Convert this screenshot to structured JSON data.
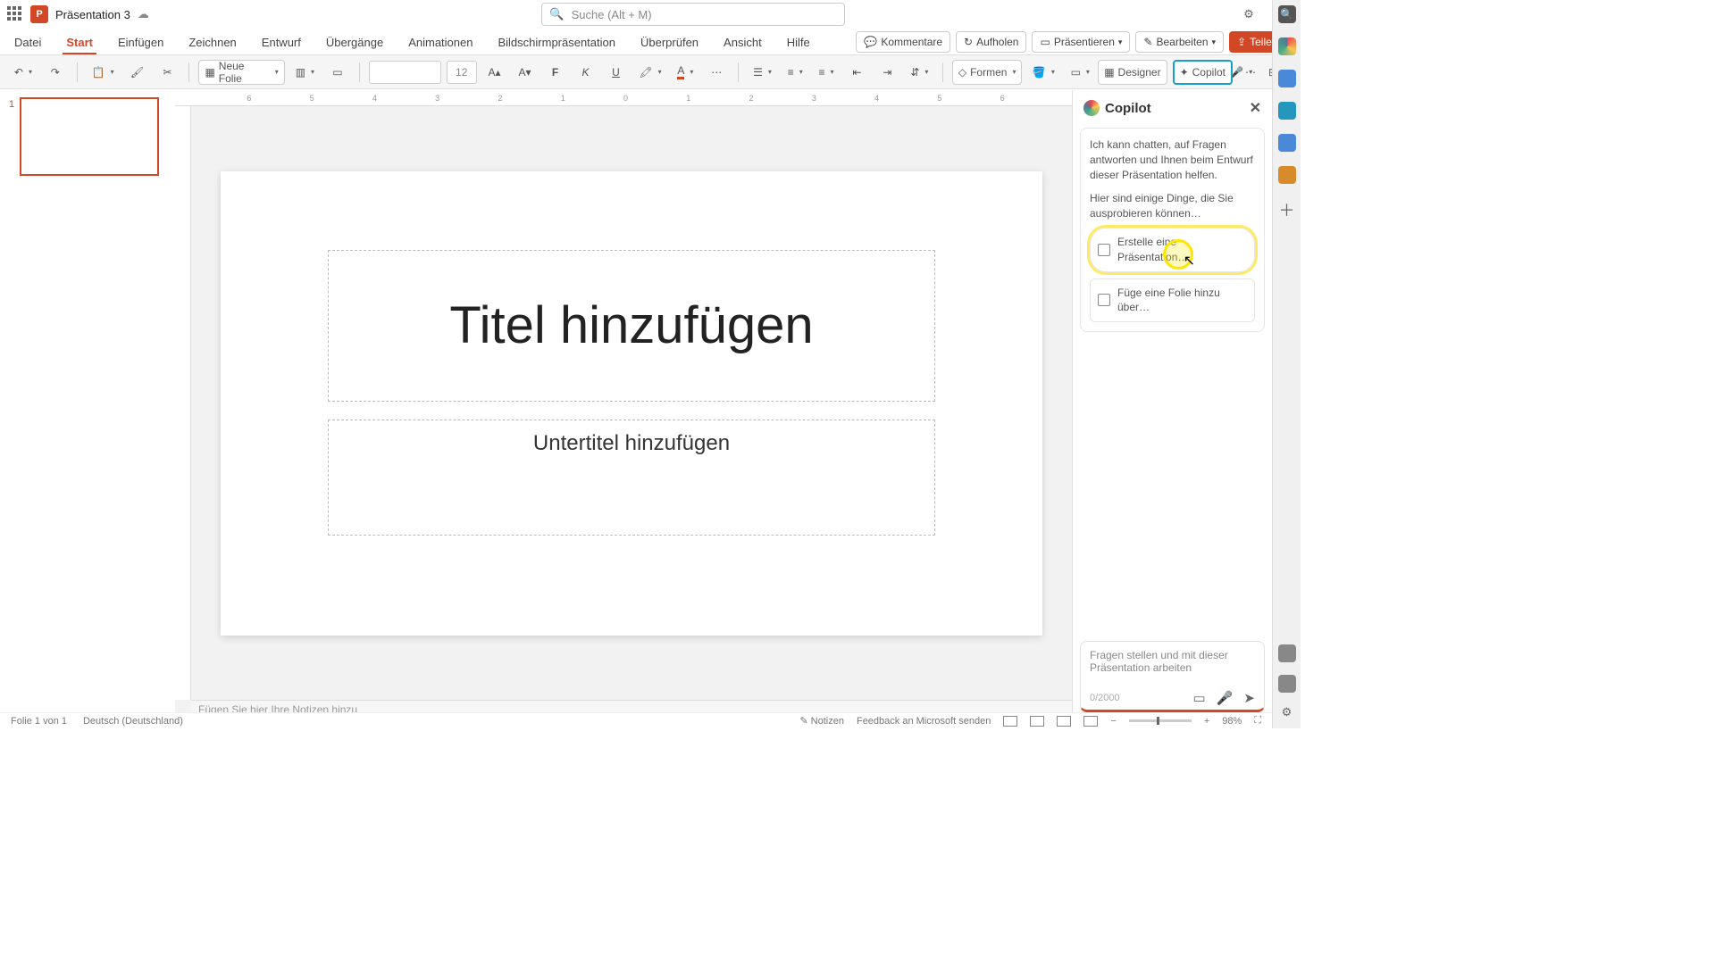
{
  "titlebar": {
    "doc_name": "Präsentation 3",
    "search_placeholder": "Suche (Alt + M)"
  },
  "ribbon": {
    "tabs": [
      "Datei",
      "Start",
      "Einfügen",
      "Zeichnen",
      "Entwurf",
      "Übergänge",
      "Animationen",
      "Bildschirmpräsentation",
      "Überprüfen",
      "Ansicht",
      "Hilfe"
    ],
    "active_index": 1,
    "right": {
      "comments": "Kommentare",
      "catchup": "Aufholen",
      "present": "Präsentieren",
      "edit": "Bearbeiten",
      "share": "Teilen"
    }
  },
  "toolbar": {
    "new_slide": "Neue Folie",
    "font_size": "12",
    "shapes": "Formen",
    "designer": "Designer",
    "copilot": "Copilot"
  },
  "thumbs": {
    "slide1_num": "1"
  },
  "slide": {
    "title_placeholder": "Titel hinzufügen",
    "subtitle_placeholder": "Untertitel hinzufügen",
    "notes_placeholder": "Fügen Sie hier Ihre Notizen hinzu"
  },
  "copilot": {
    "title": "Copilot",
    "intro": "Ich kann chatten, auf Fragen antworten und Ihnen beim Entwurf dieser Präsentation helfen.",
    "try_hint": "Hier sind einige Dinge, die Sie ausprobieren können…",
    "sugg1": "Erstelle eine Präsentation…",
    "sugg2": "Füge eine Folie hinzu über…",
    "input_placeholder": "Fragen stellen und mit dieser Präsentation arbeiten",
    "char_count": "0/2000"
  },
  "statusbar": {
    "slide_info": "Folie 1 von 1",
    "language": "Deutsch (Deutschland)",
    "notes": "Notizen",
    "feedback": "Feedback an Microsoft senden",
    "zoom": "98%"
  },
  "ruler": {
    "marks": [
      "6",
      "5",
      "4",
      "3",
      "2",
      "1",
      "0",
      "1",
      "2",
      "3",
      "4",
      "5",
      "6"
    ]
  }
}
